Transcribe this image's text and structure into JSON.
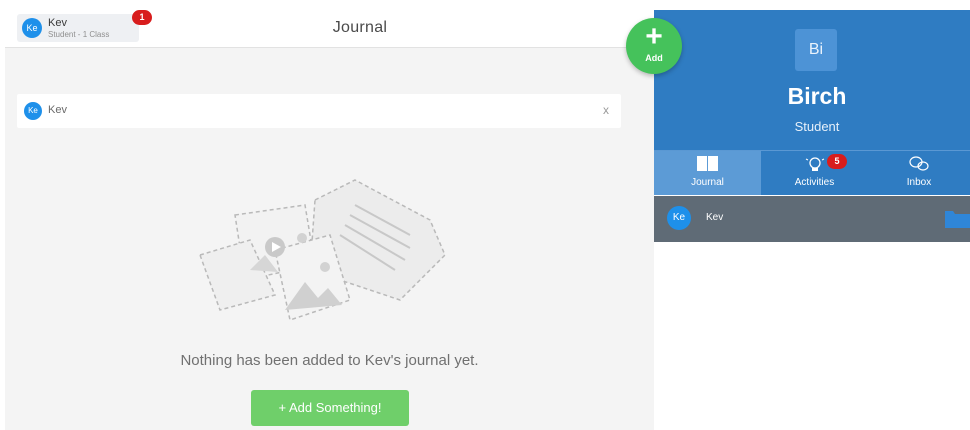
{
  "header": {
    "user_chip": {
      "avatar_initials": "Ke",
      "name": "Kev",
      "subtitle": "Student - 1 Class",
      "notification_count": "1"
    },
    "title": "Journal"
  },
  "filter": {
    "avatar_initials": "Ke",
    "name": "Kev",
    "clear_label": "x"
  },
  "empty_state": {
    "message": "Nothing has been added to Kev's journal yet.",
    "add_button_label": "+ Add Something!"
  },
  "fab": {
    "plus": "+",
    "label": "Add",
    "color": "#45c25b"
  },
  "class_panel": {
    "initials": "Bi",
    "name": "Birch",
    "role": "Student",
    "accent": "#2f7cc2",
    "tabs": [
      {
        "label": "Journal",
        "icon": "book-icon",
        "active": true
      },
      {
        "label": "Activities",
        "icon": "lightbulb-icon",
        "badge": "5"
      },
      {
        "label": "Inbox",
        "icon": "chat-bubbles-icon"
      }
    ],
    "students": [
      {
        "avatar_initials": "Ke",
        "name": "Kev",
        "icon": "folder-icon"
      }
    ]
  }
}
